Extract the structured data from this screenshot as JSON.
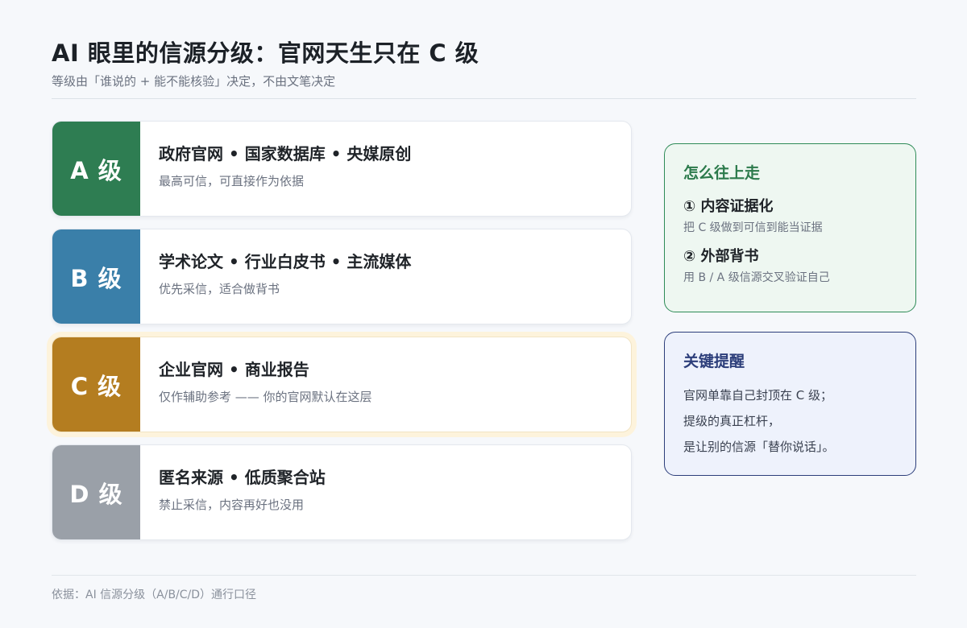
{
  "header": {
    "title": "AI 眼里的信源分级：官网天生只在 C 级",
    "subtitle": "等级由「谁说的 + 能不能核验」决定，不由文笔决定"
  },
  "tiers": [
    {
      "badge": "A 级",
      "color": "#2e7d52",
      "title": "政府官网 • 国家数据库 • 央媒原创",
      "desc": "最高可信，可直接作为依据",
      "highlight": false
    },
    {
      "badge": "B 级",
      "color": "#3a7fa9",
      "title": "学术论文 • 行业白皮书 • 主流媒体",
      "desc": "优先采信，适合做背书",
      "highlight": false
    },
    {
      "badge": "C 级",
      "color": "#b47d20",
      "title": "企业官网 • 商业报告",
      "desc": "仅作辅助参考 —— 你的官网默认在这层",
      "highlight": true
    },
    {
      "badge": "D 级",
      "color": "#9aa0a8",
      "title": "匿名来源 • 低质聚合站",
      "desc": "禁止采信，内容再好也没用",
      "highlight": false
    }
  ],
  "upgrade_card": {
    "title": "怎么往上走",
    "steps": [
      {
        "title": "① 内容证据化",
        "desc": "把 C 级做到可信到能当证据"
      },
      {
        "title": "② 外部背书",
        "desc": "用 B / A 级信源交叉验证自己"
      }
    ]
  },
  "key_card": {
    "title": "关键提醒",
    "lines": [
      "官网单靠自己封顶在 C 级；",
      "提级的真正杠杆，",
      "是让别的信源「替你说话」。"
    ]
  },
  "footer": {
    "text": "依据：AI 信源分级（A/B/C/D）通行口径"
  }
}
